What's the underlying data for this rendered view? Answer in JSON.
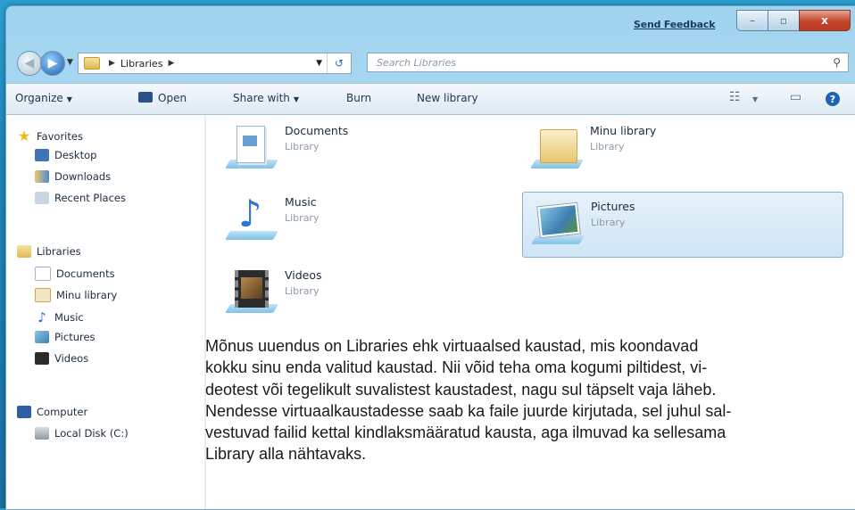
{
  "titlebar": {
    "feedback_label": "Send Feedback",
    "minimize_glyph": "–",
    "maximize_glyph": "▫",
    "close_glyph": "x"
  },
  "address": {
    "crumbs": [
      "Libraries"
    ],
    "search_placeholder": "Search Libraries"
  },
  "toolbar": {
    "organize": "Organize",
    "open": "Open",
    "share_with": "Share with",
    "burn": "Burn",
    "new_library": "New library"
  },
  "nav": {
    "favorites": "Favorites",
    "desktop": "Desktop",
    "downloads": "Downloads",
    "recent_places": "Recent Places",
    "libraries": "Libraries",
    "documents": "Documents",
    "minu_library": "Minu library",
    "music": "Music",
    "pictures": "Pictures",
    "videos": "Videos",
    "computer": "Computer",
    "local_disk": "Local Disk (C:)"
  },
  "libraries": [
    {
      "name": "Documents",
      "type": "Library",
      "icon": "document-library-icon"
    },
    {
      "name": "Minu library",
      "type": "Library",
      "icon": "folder-library-icon"
    },
    {
      "name": "Music",
      "type": "Library",
      "icon": "music-library-icon"
    },
    {
      "name": "Pictures",
      "type": "Library",
      "icon": "pictures-library-icon"
    },
    {
      "name": "Videos",
      "type": "Library",
      "icon": "videos-library-icon"
    }
  ],
  "description": "Mõnus uuendus on Libraries ehk virtuaalsed kaustad, mis koondavad\nkokku sinu enda valitud kaustad. Nii võid teha oma kogumi piltidest, vi-\ndeotest või tegelikult suvalistest kaustadest, nagu sul täpselt vaja läheb.\nNendesse virtuaalkaustadesse saab ka faile juurde kirjutada, sel juhul sal-\nvestuvad failid kettal kindlaksmääratud kausta, aga ilmuvad ka sellesama\nLibrary alla nähtavaks."
}
